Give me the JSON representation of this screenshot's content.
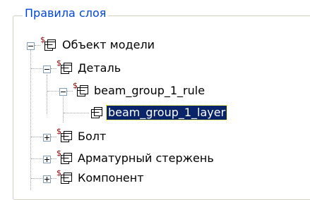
{
  "group": {
    "title": "Правила слоя"
  },
  "tree": {
    "root": {
      "label": "Объект модели",
      "expanded": true,
      "marker": "$"
    },
    "detail": {
      "label": "Деталь",
      "expanded": true,
      "marker": "$"
    },
    "rule": {
      "label": "beam_group_1_rule",
      "expanded": true,
      "marker": "$"
    },
    "layer": {
      "label": "beam_group_1_layer",
      "selected": true
    },
    "bolt": {
      "label": "Болт",
      "expanded": false,
      "marker": "$"
    },
    "rebar": {
      "label": "Арматурный стержень",
      "expanded": false,
      "marker": "$"
    },
    "component": {
      "label": "Компонент",
      "expanded": false,
      "marker": "$"
    }
  },
  "colors": {
    "group_title": "#0046d5",
    "selection_bg": "#0a246a",
    "marker": "#a00000"
  },
  "icons": {
    "node": "window-tree-node-icon",
    "expander_open": "minus-box-icon",
    "expander_closed": "plus-box-icon"
  }
}
